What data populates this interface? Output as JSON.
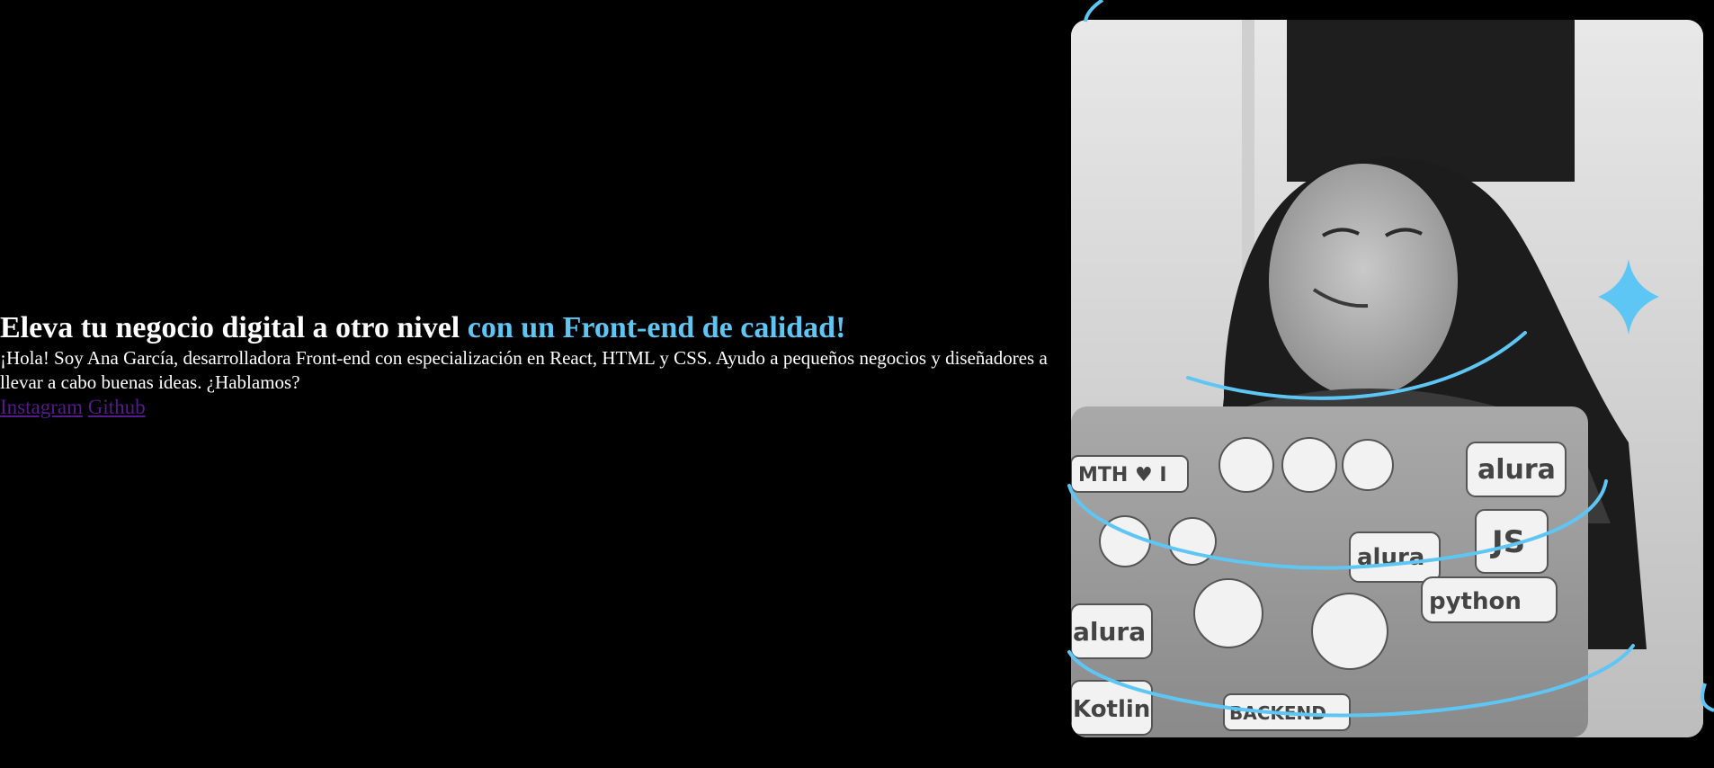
{
  "hero": {
    "title_main": "Eleva tu negocio digital a otro nivel ",
    "title_accent": "con un Front-end de calidad!",
    "description": "¡Hola! Soy Ana García, desarrolladora Front-end con especialización en React, HTML y CSS. Ayudo a pequeños negocios y diseñadores a llevar a cabo buenas ideas. ¿Hablamos?"
  },
  "links": {
    "instagram": "Instagram",
    "github": "Github"
  },
  "photo": {
    "stickers": [
      "MTH ♥ I",
      "alura",
      "JS",
      "python",
      "alura",
      "BACKEND",
      "Kotlin",
      "alura"
    ]
  },
  "colors": {
    "background": "#000000",
    "accent": "#5ec6f5",
    "link": "#551a8b",
    "text": "#ffffff"
  }
}
